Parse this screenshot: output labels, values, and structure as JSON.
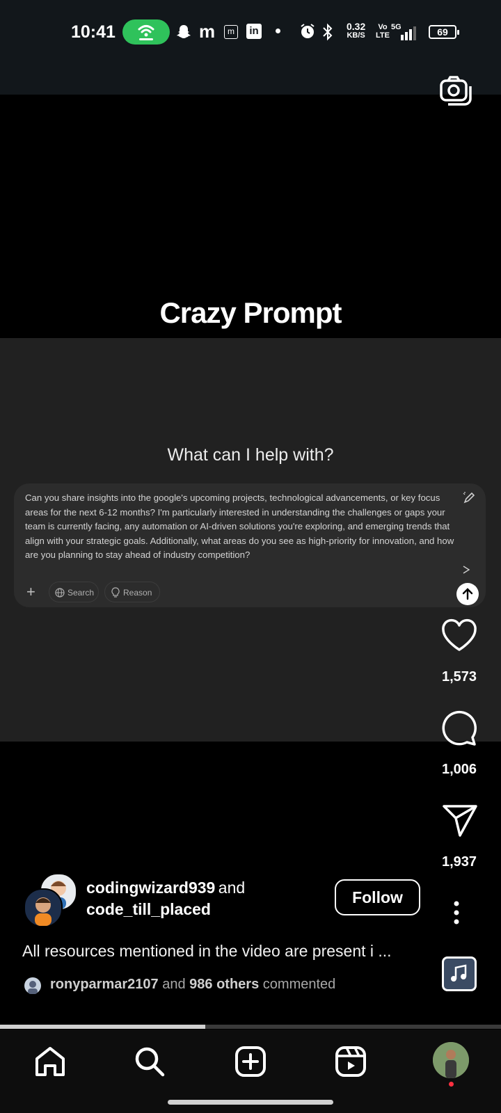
{
  "status_bar": {
    "time": "10:41",
    "speed_value": "0.32",
    "speed_unit": "KB/S",
    "volte_top": "Vo",
    "volte_bottom": "LTE",
    "network": "5G",
    "battery": "69",
    "icons": [
      "hotspot-icon",
      "snapchat-icon",
      "m-icon",
      "m-box-icon",
      "linkedin-icon",
      "dot-icon",
      "alarm-icon",
      "bluetooth-icon",
      "signal-icon"
    ]
  },
  "video": {
    "title": "Crazy Prompt",
    "panel_heading": "What can I help with?",
    "prompt_text": "Can you share insights into the google's upcoming projects, technological advancements, or key focus areas for the next 6-12 months? I'm particularly interested in understanding the challenges or gaps your team is currently facing, any automation or AI-driven solutions you're exploring, and emerging trends that align with your strategic goals. Additionally, what areas do you see as high-priority for innovation, and how are you planning to stay ahead of industry competition?",
    "search_label": "Search",
    "reason_label": "Reason"
  },
  "rail": {
    "likes": "1,573",
    "comments": "1,006",
    "shares": "1,937"
  },
  "post": {
    "author1": "codingwizard939",
    "and_text": "and",
    "author2": "code_till_placed",
    "follow_label": "Follow",
    "caption": "All resources mentioned in the video are present i ...",
    "commenter": "ronyparmar2107",
    "commenter_and": "and",
    "others": "986 others",
    "commented": "commented",
    "progress": 0.41
  },
  "nav": {
    "items": [
      "home-icon",
      "search-icon",
      "create-icon",
      "reels-icon",
      "profile-avatar"
    ]
  }
}
